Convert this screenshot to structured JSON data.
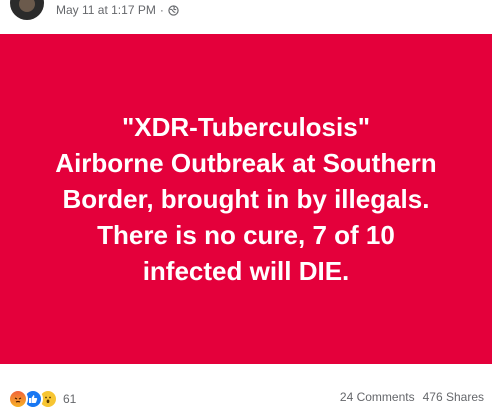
{
  "post": {
    "timestamp": "May 11 at 1:17 PM",
    "separator": "·",
    "privacy_icon": "globe-icon",
    "background_color": "#e4003b",
    "text_lines": [
      "\"XDR-Tuberculosis\"",
      "Airborne Outbreak at Southern",
      "Border, brought in by illegals.",
      "There is no cure, 7 of 10",
      "infected will DIE."
    ]
  },
  "footer": {
    "reaction_icons": [
      "angry-icon",
      "like-icon",
      "wow-icon"
    ],
    "reaction_count": "61",
    "comments": "24 Comments",
    "shares": "476 Shares"
  }
}
